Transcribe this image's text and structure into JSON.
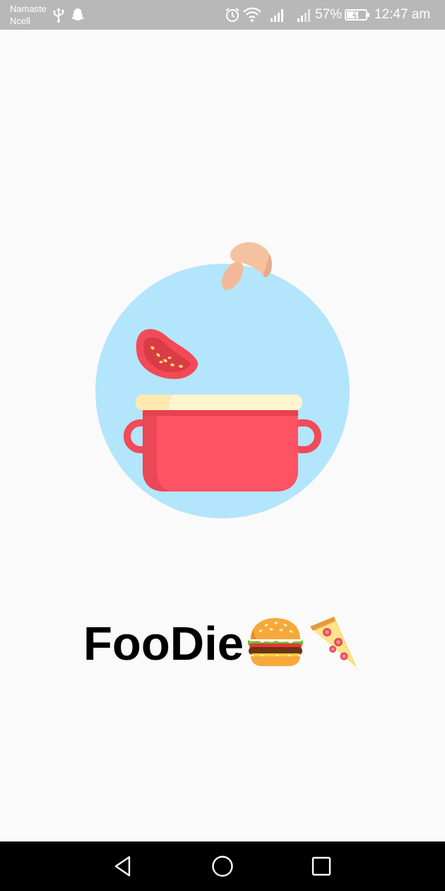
{
  "status_bar": {
    "carrier_line1": "Namaste",
    "carrier_line2": "Ncell",
    "battery_percent": "57%",
    "time": "12:47 am",
    "icons": [
      "usb-icon",
      "snapchat-icon",
      "alarm-icon",
      "wifi-icon",
      "signal-icon",
      "signal-icon",
      "battery-icon"
    ]
  },
  "splash": {
    "app_name": "FooDie",
    "illustration": "cooking-pot-illustration",
    "emojis": [
      "hamburger-emoji",
      "pizza-emoji"
    ]
  },
  "nav_bar": {
    "buttons": [
      "back",
      "home",
      "recents"
    ]
  },
  "colors": {
    "status_bar": "#b8b8b8",
    "background": "#fafafa",
    "circle": "#b3e5fc",
    "pot": "#ff5262",
    "pot_rim": "#fff5cf",
    "tomato": "#f24a57",
    "mushroom": "#f5c2a0",
    "nav_bar": "#000000"
  }
}
